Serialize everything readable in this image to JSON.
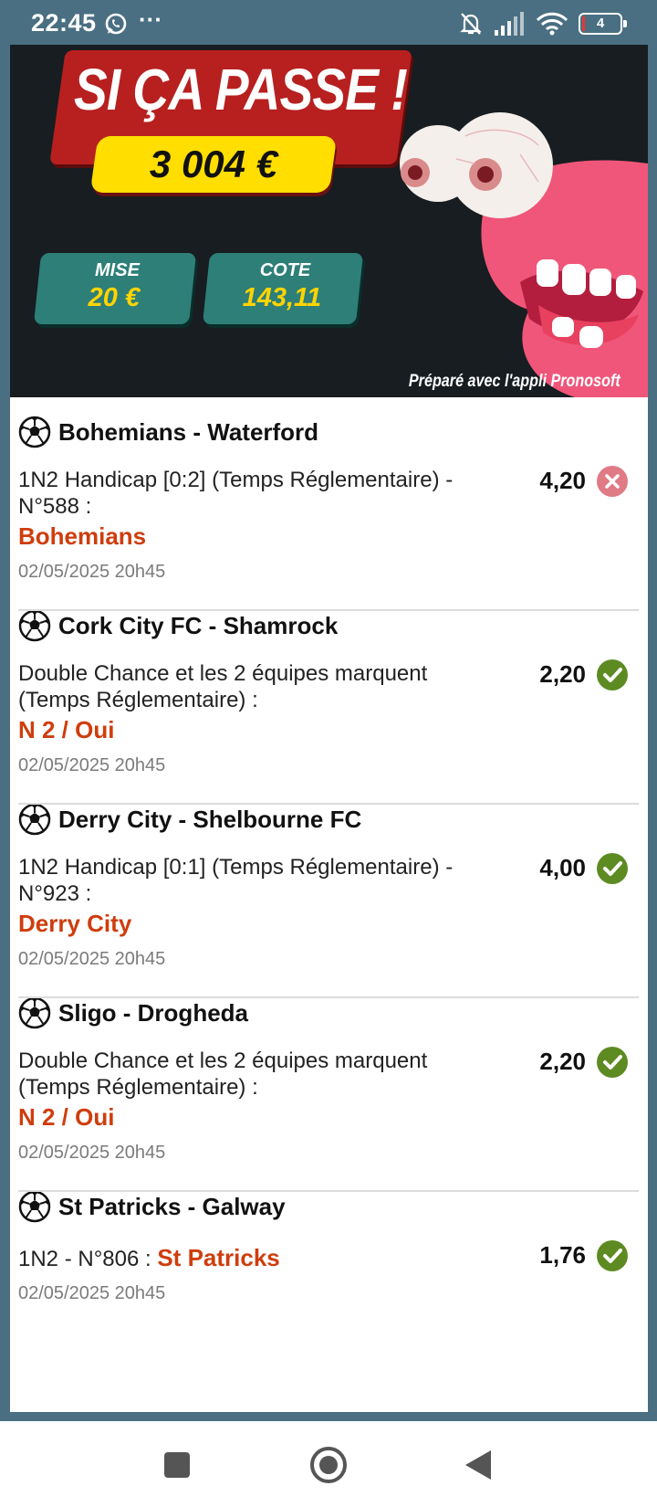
{
  "status_bar": {
    "time": "22:45",
    "dots": "···",
    "battery_level": "4"
  },
  "banner": {
    "headline": "SI ÇA PASSE !",
    "gain": "3 004 €",
    "mise_label": "MISE",
    "mise_value": "20 €",
    "cote_label": "COTE",
    "cote_value": "143,11",
    "credit": "Préparé avec l'appli Pronosoft"
  },
  "bets": [
    {
      "match": "Bohemians - Waterford",
      "market": "1N2 Handicap [0:2] (Temps Réglementaire) - N°588 :",
      "pick": "Bohemians",
      "odds": "4,20",
      "result": "lose",
      "date": "02/05/2025 20h45"
    },
    {
      "match": "Cork City FC - Shamrock",
      "market": "Double Chance et les 2 équipes marquent (Temps Réglementaire) :",
      "pick": "N 2 / Oui",
      "odds": "2,20",
      "result": "win",
      "date": "02/05/2025 20h45"
    },
    {
      "match": "Derry City - Shelbourne FC",
      "market": "1N2 Handicap [0:1] (Temps Réglementaire) - N°923 :",
      "pick": "Derry City",
      "odds": "4,00",
      "result": "win",
      "date": "02/05/2025 20h45"
    },
    {
      "match": "Sligo - Drogheda",
      "market": "Double Chance et les 2 équipes marquent (Temps Réglementaire) :",
      "pick": "N 2 / Oui",
      "odds": "2,20",
      "result": "win",
      "date": "02/05/2025 20h45"
    },
    {
      "match": "St Patricks - Galway",
      "market": "1N2 - N°806 :",
      "pick": "St Patricks",
      "odds": "1,76",
      "result": "win",
      "date": "02/05/2025 20h45"
    }
  ],
  "colors": {
    "pick": "#cf3d0d",
    "win": "#5d8b22",
    "lose": "#e07a84",
    "banner_red": "#b7201f",
    "banner_yellow": "#ffde00",
    "stat_teal": "#2d7f78"
  },
  "icons": {
    "sport": "soccer-ball-icon",
    "win": "check-icon",
    "lose": "cross-icon"
  }
}
